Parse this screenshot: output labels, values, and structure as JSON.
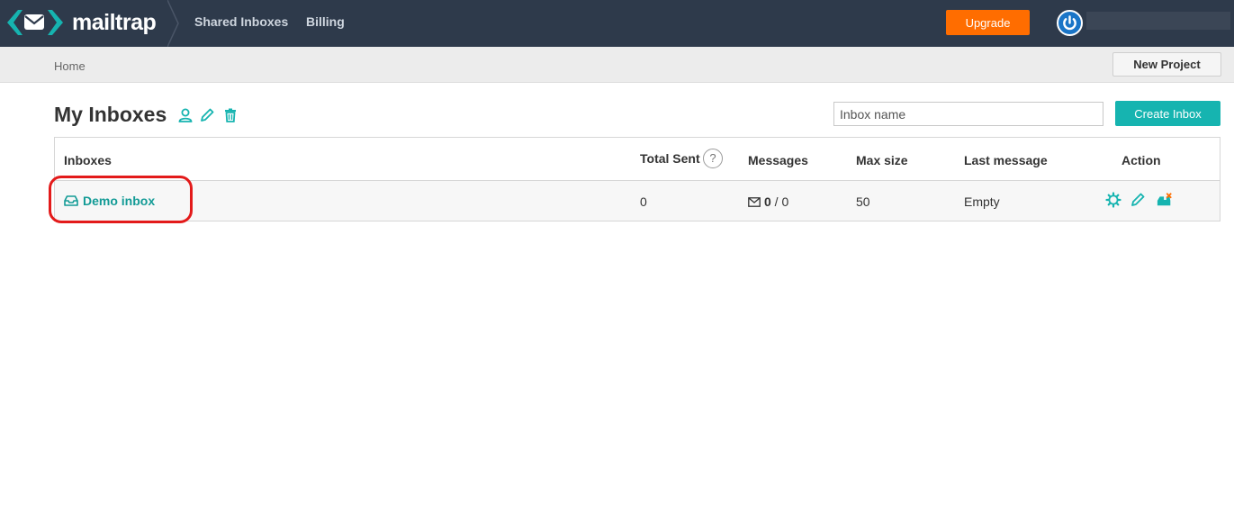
{
  "app": {
    "brand": "mailtrap",
    "accent_color": "#16b4b0",
    "nav_bg_color": "#2e3a4b",
    "upgrade_color": "#ff6d00"
  },
  "nav": {
    "links": [
      "Shared Inboxes",
      "Billing"
    ],
    "upgrade_label": "Upgrade"
  },
  "breadcrumb": {
    "home": "Home",
    "new_project_label": "New Project"
  },
  "page": {
    "title": "My Inboxes",
    "title_icons": [
      "user-icon",
      "pencil-icon",
      "trash-icon"
    ],
    "search": {
      "placeholder": "Inbox name",
      "value": ""
    },
    "create_label": "Create Inbox"
  },
  "table": {
    "headers": {
      "inboxes": "Inboxes",
      "total_sent": "Total Sent",
      "help": "?",
      "messages": "Messages",
      "max_size": "Max size",
      "last_message": "Last message",
      "action": "Action"
    },
    "rows": [
      {
        "name": "Demo inbox",
        "total_sent": "0",
        "messages_unread": "0",
        "messages_sep": " / ",
        "messages_total": "0",
        "max_size": "50",
        "last_message": "Empty",
        "actions": [
          "gear-icon",
          "pencil-icon",
          "clear-inbox-icon"
        ]
      }
    ]
  },
  "annotation": {
    "highlight_color": "#e31a1a"
  }
}
